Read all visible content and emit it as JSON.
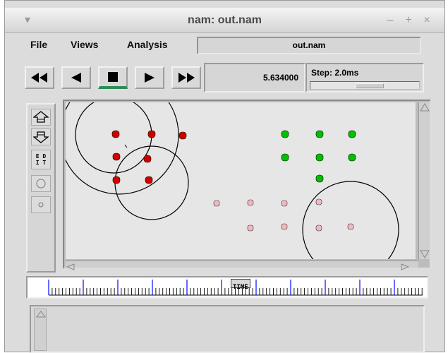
{
  "window": {
    "title": "nam: out.nam",
    "controls": [
      "minimize-icon",
      "maximize-icon",
      "close-icon"
    ]
  },
  "menu": {
    "file": "File",
    "views": "Views",
    "analysis": "Analysis",
    "filename": "out.nam"
  },
  "transport": {
    "buttons": [
      "rewind-icon",
      "step-back-icon",
      "stop-icon",
      "play-icon",
      "fast-forward-icon"
    ],
    "active_button": "stop-icon",
    "time": "5.634000",
    "step_label": "Step: 2.0ms"
  },
  "tools": [
    "zoom-in-icon",
    "zoom-out-icon",
    "edit-button",
    "circle-icon",
    "small-circle-icon"
  ],
  "edit_label_line1": "E D",
  "edit_label_line2": "I T",
  "timeline": {
    "label": "TIME"
  },
  "colors": {
    "red_node": "#d00000",
    "green_node": "#00c000",
    "pink_node": "#e8a0a8"
  }
}
